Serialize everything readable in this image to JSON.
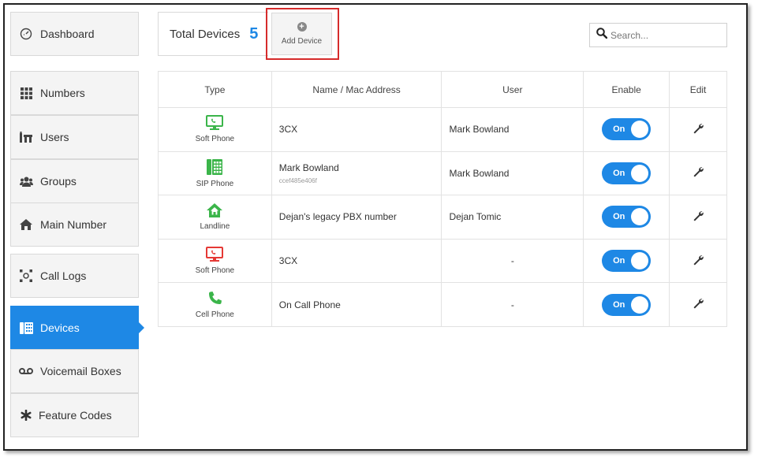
{
  "sidebar": {
    "items": [
      {
        "label": "Dashboard",
        "icon": "dashboard-gauge-icon"
      },
      {
        "label": "Numbers",
        "icon": "grid-icon"
      },
      {
        "label": "Users",
        "icon": "users-icon"
      },
      {
        "label": "Groups",
        "icon": "groups-icon"
      },
      {
        "label": "Main Number",
        "icon": "home-icon"
      },
      {
        "label": "Call Logs",
        "icon": "call-logs-icon"
      },
      {
        "label": "Devices",
        "icon": "devices-icon",
        "active": true
      },
      {
        "label": "Voicemail Boxes",
        "icon": "voicemail-icon"
      },
      {
        "label": "Feature Codes",
        "icon": "asterisk-icon"
      }
    ]
  },
  "header": {
    "total_label": "Total Devices",
    "total_count": "5",
    "add_device_label": "Add Device",
    "search_placeholder": "Search..."
  },
  "table": {
    "columns": [
      "Type",
      "Name / Mac Address",
      "User",
      "Enable",
      "Edit"
    ],
    "rows": [
      {
        "type": "Soft Phone",
        "icon": "soft-phone-icon",
        "icon_color": "#3bb54a",
        "name": "3CX",
        "mac": "",
        "user": "Mark Bowland",
        "enable": "On"
      },
      {
        "type": "SIP Phone",
        "icon": "sip-phone-icon",
        "icon_color": "#3bb54a",
        "name": "Mark Bowland",
        "mac": "ccef485e406f",
        "user": "Mark Bowland",
        "enable": "On"
      },
      {
        "type": "Landline",
        "icon": "landline-home-icon",
        "icon_color": "#3bb54a",
        "name": "Dejan's legacy PBX number",
        "mac": "",
        "user": "Dejan Tomic",
        "enable": "On"
      },
      {
        "type": "Soft Phone",
        "icon": "soft-phone-icon",
        "icon_color": "#e53935",
        "name": "3CX",
        "mac": "",
        "user": "-",
        "enable": "On"
      },
      {
        "type": "Cell Phone",
        "icon": "cell-phone-icon",
        "icon_color": "#3bb54a",
        "name": "On Call Phone",
        "mac": "",
        "user": "-",
        "enable": "On"
      }
    ]
  },
  "colors": {
    "accent": "#1e88e5",
    "highlight": "#d62b2b",
    "green": "#3bb54a",
    "red": "#e53935"
  }
}
